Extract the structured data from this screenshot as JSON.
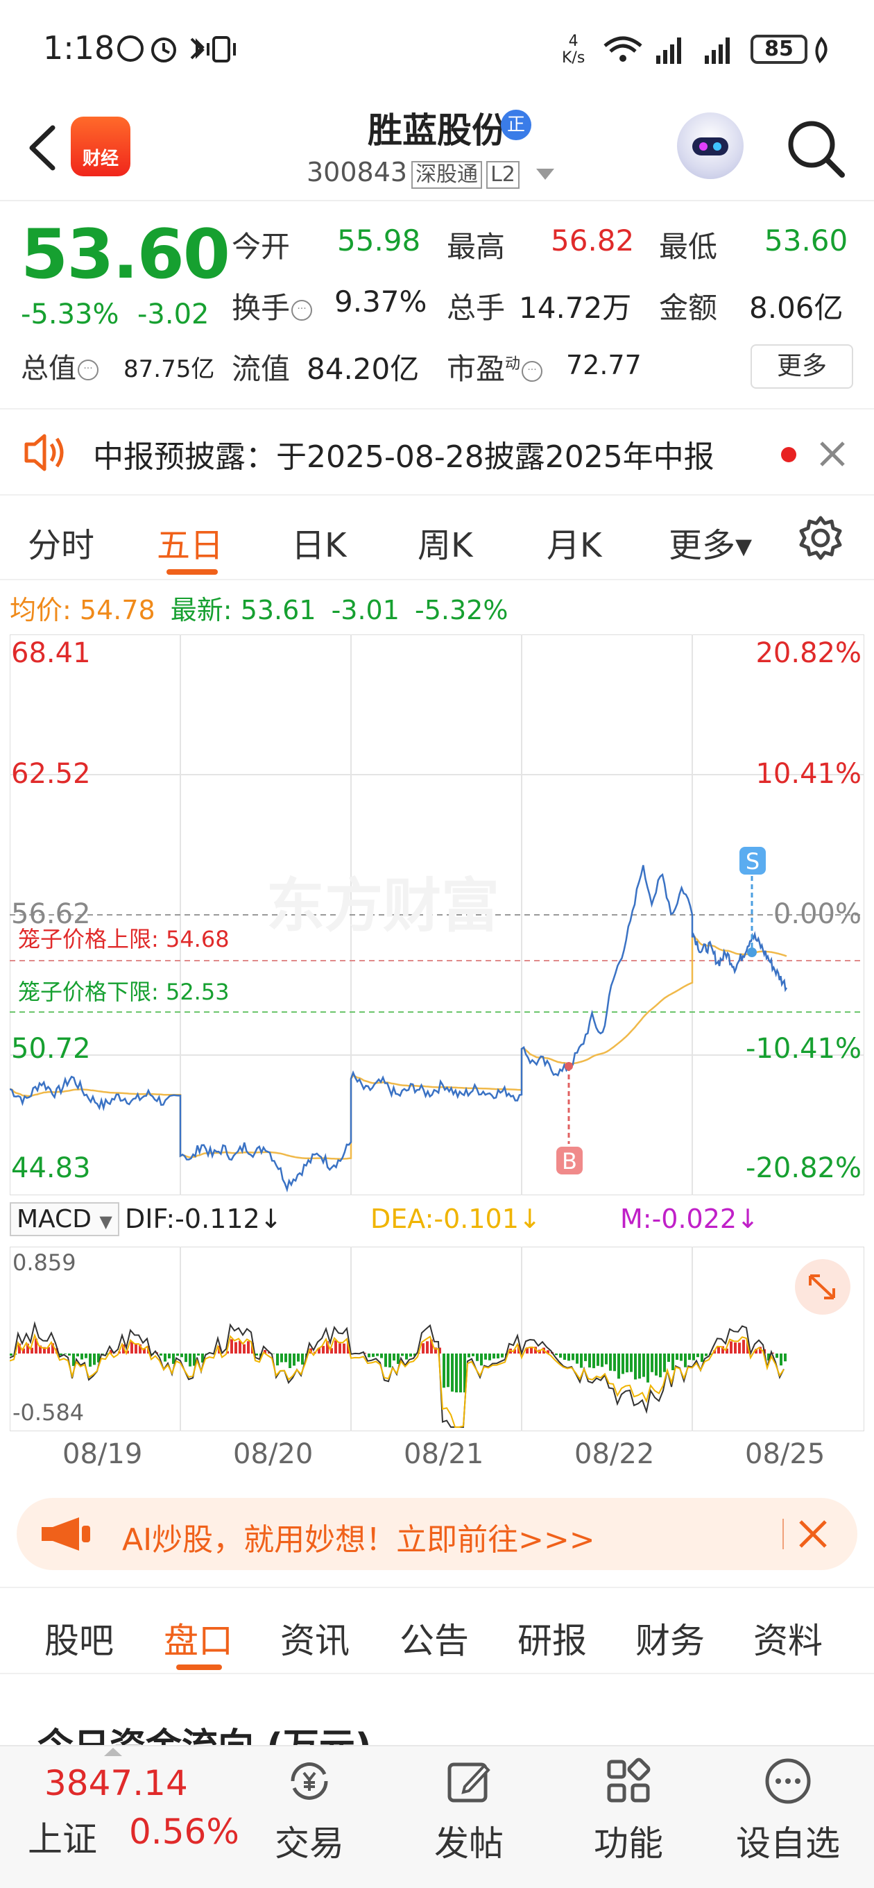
{
  "status_bar": {
    "time": "1:18",
    "speed_value": "4",
    "speed_unit": "K/s",
    "battery": "85"
  },
  "header": {
    "logo_text": "财经",
    "stock_name": "胜蓝股份",
    "badge": "正",
    "code": "300843",
    "tag1": "深股通",
    "tag2": "L2"
  },
  "quote": {
    "price": "53.60",
    "change_pct": "-5.33%",
    "change_amt": "-3.02",
    "open_label": "今开",
    "open": "55.98",
    "high_label": "最高",
    "high": "56.82",
    "low_label": "最低",
    "low": "53.60",
    "turnover_label": "换手",
    "turnover": "9.37%",
    "volume_label": "总手",
    "volume": "14.72万",
    "amount_label": "金额",
    "amount": "8.06亿",
    "mcap_label": "总值",
    "mcap": "87.75亿",
    "float_label": "流值",
    "float": "84.20亿",
    "pe_label": "市盈",
    "pe_sup": "动",
    "pe": "72.77",
    "more": "更多"
  },
  "notice": {
    "text": "中报预披露：于2025-08-28披露2025年中报"
  },
  "tabs": [
    "分时",
    "五日",
    "日K",
    "周K",
    "月K",
    "更多▾"
  ],
  "chart_info": {
    "avg_label": "均价:",
    "avg": "54.78",
    "latest_label": "最新:",
    "latest": "53.61",
    "chg": "-3.01",
    "pct": "-5.32%"
  },
  "chart_labels": {
    "y_left": [
      "68.41",
      "62.52",
      "56.62",
      "50.72",
      "44.83"
    ],
    "y_right": [
      "20.82%",
      "10.41%",
      "0.00%",
      "-10.41%",
      "-20.82%"
    ],
    "cage_upper": "笼子价格上限:  54.68",
    "cage_lower": "笼子价格下限:  52.53",
    "watermark": "东方财富",
    "buy_mark": "B",
    "sell_mark": "S"
  },
  "macd": {
    "selector": "MACD",
    "dif": "DIF:-0.112↓",
    "dea": "DEA:-0.101↓",
    "m": "M:-0.022↓",
    "top": "0.859",
    "bottom": "-0.584"
  },
  "dates": [
    "08/19",
    "08/20",
    "08/21",
    "08/22",
    "08/25"
  ],
  "ad": {
    "text": "AI炒股，就用妙想！立即前往>>>"
  },
  "bottom_tabs": [
    "股吧",
    "盘口",
    "资讯",
    "公告",
    "研报",
    "财务",
    "资料"
  ],
  "section_title": "今日资金流向 (万元)",
  "bottom_nav": {
    "index_value": "3847.14",
    "index_name": "上证",
    "index_pct": "0.56%",
    "items": [
      "交易",
      "发帖",
      "功能",
      "设自选"
    ]
  },
  "colors": {
    "up": "#e02a2a",
    "down": "#16a030",
    "accent": "#f0611a",
    "avg_line": "#f0b94a",
    "price_line": "#3a72c4"
  },
  "chart_data": {
    "type": "line",
    "x": [
      "08/19",
      "08/20",
      "08/21",
      "08/22",
      "08/25"
    ],
    "series": [
      {
        "name": "price_day_close",
        "values": [
          48.8,
          46.6,
          49.5,
          57.0,
          53.61
        ]
      }
    ],
    "ylim": [
      44.83,
      68.41
    ],
    "prev_close": 56.62,
    "avg_price": 54.78
  }
}
